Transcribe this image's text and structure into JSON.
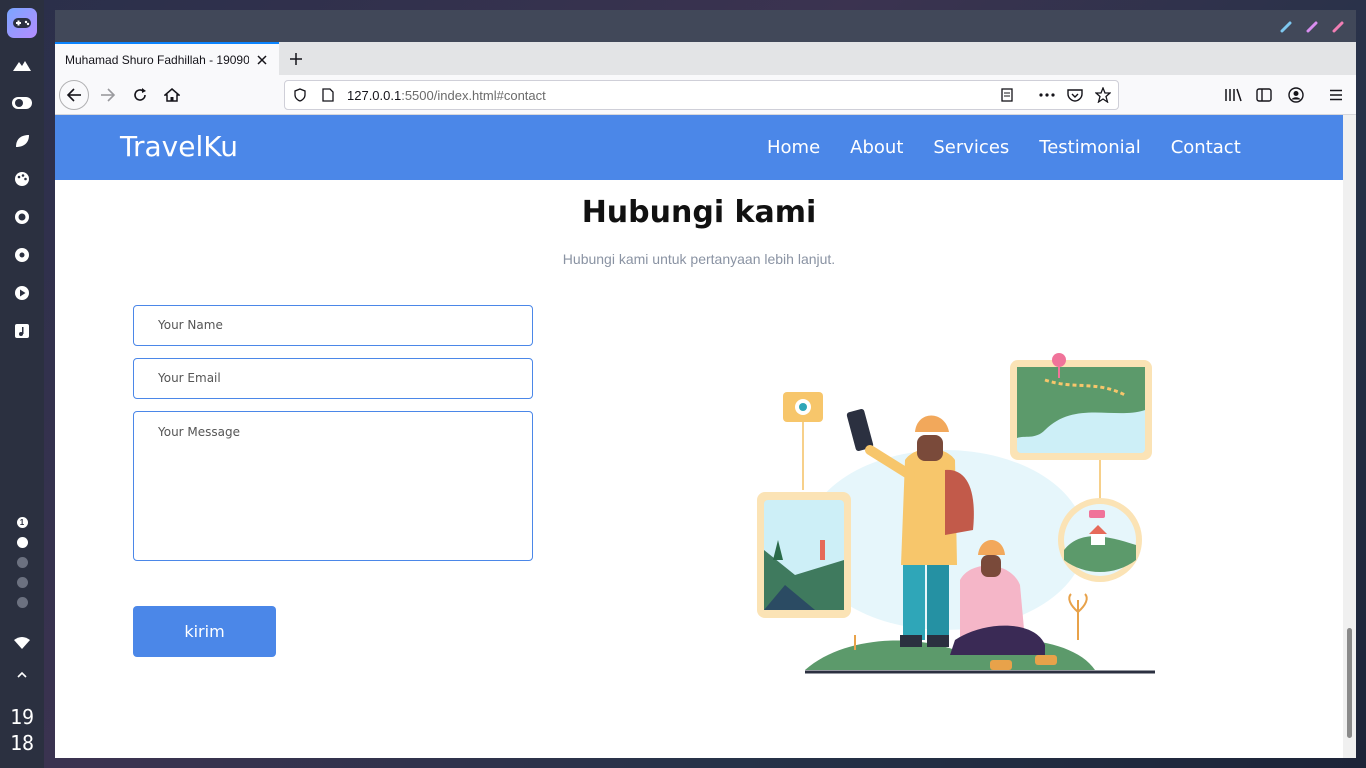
{
  "desktop": {
    "clock": {
      "hour": "19",
      "minute": "18"
    },
    "workspace_number": "1"
  },
  "browser": {
    "tab": {
      "title": "Muhamad Shuro Fadhillah - 19090"
    },
    "url": {
      "host": "127.0.0.1",
      "rest": ":5500/index.html#contact"
    }
  },
  "site": {
    "brand": "TravelKu",
    "menu": [
      "Home",
      "About",
      "Services",
      "Testimonial",
      "Contact"
    ],
    "heading": "Hubungi kami",
    "subheading": "Hubungi kami untuk pertanyaan lebih lanjut.",
    "form": {
      "name_placeholder": "Your Name",
      "email_placeholder": "Your Email",
      "message_placeholder": "Your Message",
      "submit_label": "kirim"
    }
  },
  "colors": {
    "accent": "#4b87e8",
    "titlebar": "#414859",
    "dock": "#2b3040"
  }
}
